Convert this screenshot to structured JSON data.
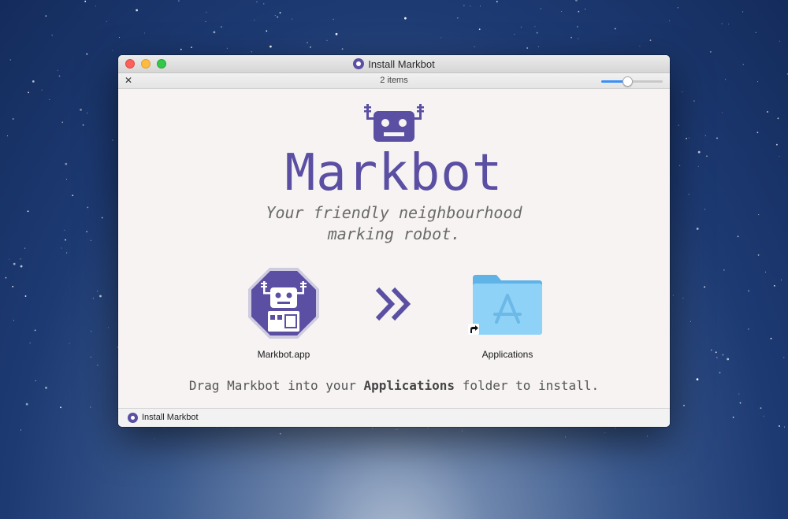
{
  "window": {
    "title": "Install Markbot",
    "items_count": "2 items",
    "icon_size_slider": 0.4
  },
  "content": {
    "app_name": "Markbot",
    "tagline_line1": "Your friendly neighbourhood",
    "tagline_line2": "marking robot.",
    "app_file_label": "Markbot.app",
    "applications_label": "Applications",
    "instruction_prefix": "Drag Markbot into your ",
    "instruction_bold": "Applications",
    "instruction_suffix": " folder to install."
  },
  "statusbar": {
    "path_label": "Install Markbot"
  },
  "icons": {
    "title_proxy": "disk-image-icon",
    "toolbar_action": "tools-icon",
    "robot": "robot-icon",
    "app_icon": "markbot-app-icon",
    "arrow": "double-chevron-right-icon",
    "folder": "applications-folder-icon",
    "alias": "alias-arrow-icon",
    "status": "disk-image-icon"
  },
  "colors": {
    "brand_purple": "#5b4fa3",
    "folder_blue": "#7cc8f2",
    "slider_accent": "#3b8ff6"
  }
}
